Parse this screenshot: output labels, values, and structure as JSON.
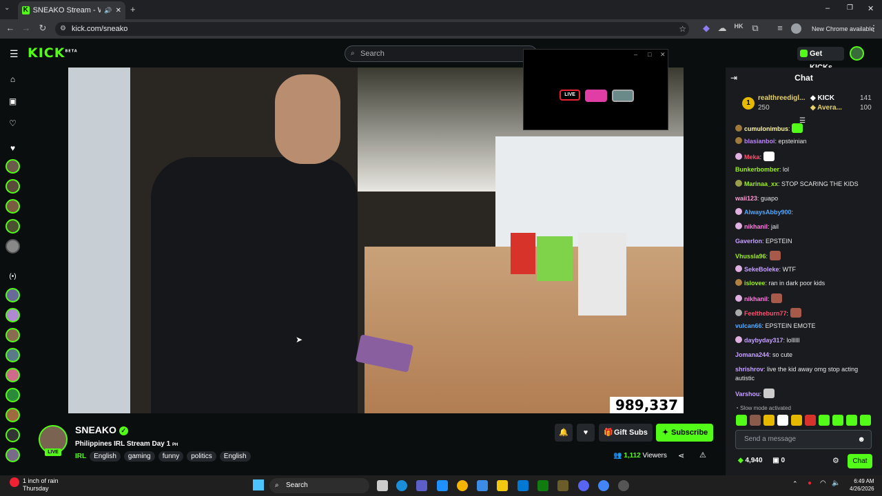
{
  "browser": {
    "tab_title": "SNEAKO Stream - Watch Li",
    "url": "kick.com/sneako",
    "new_chrome": "New Chrome available"
  },
  "header": {
    "logo": "KICK",
    "logo_sup": "BETA",
    "search_placeholder": "Search",
    "get_kicks": "Get KICKs"
  },
  "video": {
    "overlay_count": "989,337"
  },
  "stream": {
    "channel": "SNEAKO",
    "live": "LIVE",
    "title": "Philippines IRL Stream Day 1",
    "title_suffix": "PH",
    "category": "IRL",
    "tags": [
      "English",
      "gaming",
      "funny",
      "politics",
      "English"
    ],
    "gift_subs": "Gift Subs",
    "subscribe": "Subscribe",
    "viewers_count": "1,112",
    "viewers_label": "Viewers"
  },
  "chat": {
    "title": "Chat",
    "leaderboard": {
      "rank": "1",
      "user": "realthreedigl...",
      "user_points": "250",
      "kick_label": "KICK",
      "kick_count": "141",
      "avera_label": "Avera...",
      "avera_count": "100"
    },
    "messages": [
      {
        "user": "cumulonimbus",
        "text": "",
        "color": "#fff7a0"
      },
      {
        "user": "blasianboi",
        "text": "epsteinian",
        "color": "#bb86fc"
      },
      {
        "user": "Meka",
        "text": "",
        "color": "#ff4f6d"
      },
      {
        "user": "Bunkerbomber",
        "text": "lol",
        "color": "#9ef01a"
      },
      {
        "user": "Marinaa_xx",
        "text": "STOP SCARING THE KIDS",
        "color": "#9ef01a"
      },
      {
        "user": "waii123",
        "text": "guapo",
        "color": "#ff9bd2"
      },
      {
        "user": "AlwaysAbby900",
        "text": "",
        "color": "#53a8ff"
      },
      {
        "user": "nikhanil",
        "text": "jail",
        "color": "#ff7ae0"
      },
      {
        "user": "Gaverlon",
        "text": "EPSTEIN",
        "color": "#c6a0ff"
      },
      {
        "user": "Vhussla96",
        "text": "",
        "color": "#9ef01a"
      },
      {
        "user": "SekeBoleke",
        "text": "WTF",
        "color": "#c6a0ff"
      },
      {
        "user": "islovee",
        "text": "ran in dark poor kids",
        "color": "#9ef01a"
      },
      {
        "user": "nikhanil",
        "text": "",
        "color": "#ff7ae0"
      },
      {
        "user": "Feeltheburn77",
        "text": "",
        "color": "#ff4f6d"
      },
      {
        "user": "vulcan66",
        "text": "EPSTEIN EMOTE",
        "color": "#53a8ff"
      },
      {
        "user": "daybyday317",
        "text": "lollllll",
        "color": "#c6a0ff"
      },
      {
        "user": "Jomana244",
        "text": "so cute",
        "color": "#c6a0ff"
      },
      {
        "user": "shrishrov",
        "text": "live the kid away omg stop acting autistic",
        "color": "#c6a0ff"
      },
      {
        "user": "Varshou",
        "text": "",
        "color": "#c6a0ff"
      }
    ],
    "slow_mode": "Slow mode activated",
    "input_placeholder": "Send a message",
    "kicks_balance": "4,940",
    "points_balance": "0",
    "chat_button": "Chat"
  },
  "taskbar": {
    "weather_line1": "1 inch of rain",
    "weather_line2": "Thursday",
    "search": "Search",
    "time": "6:49 AM",
    "date": "4/26/2026"
  },
  "colors": {
    "kick_green": "#53fc18",
    "background": "#0b0e0f",
    "chat_bg": "#191b1f"
  }
}
